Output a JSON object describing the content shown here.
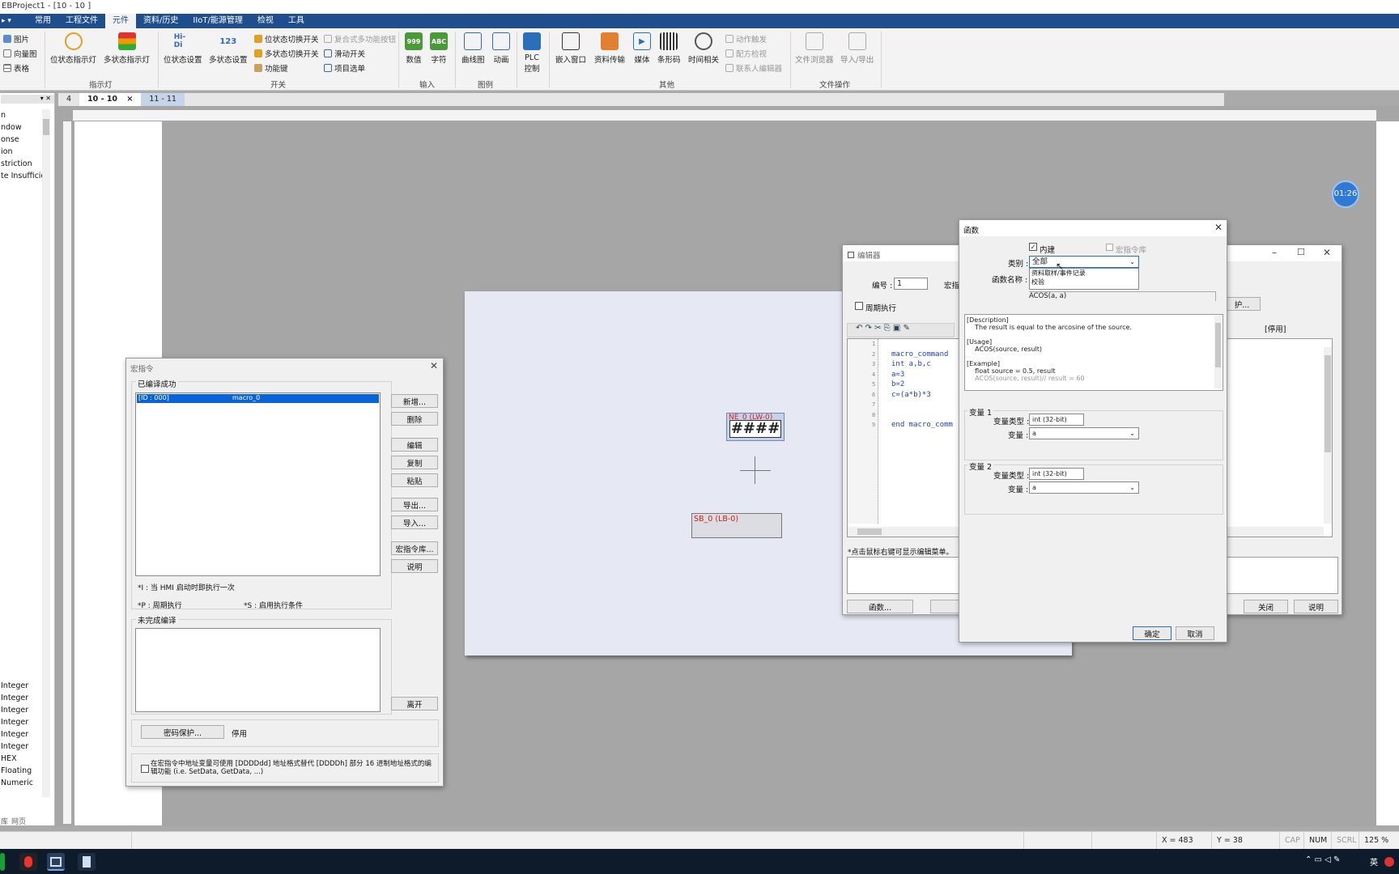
{
  "window": {
    "title": "EBProject1 - [10 - 10 ]",
    "quick_access": "▸ ▾"
  },
  "menu": [
    "常用",
    "工程文件",
    "元件",
    "资料/历史",
    "IIoT/能源管理",
    "检视",
    "工具"
  ],
  "menu_active": "元件",
  "ribbon": {
    "small_left": [
      "图片",
      "向量图",
      "表格"
    ],
    "indicator": [
      "位状态指示灯",
      "多状态指示灯"
    ],
    "indicator_group": "指示灯",
    "switch_big": [
      "位状态设置",
      "多状态设置"
    ],
    "switch_small": [
      "位状态切换开关",
      "多状态切换开关",
      "功能键",
      "复合式多功能按钮",
      "滑动开关",
      "项目选单"
    ],
    "switch_group": "开关",
    "input": [
      "数值",
      "字符"
    ],
    "input_group": "输入",
    "graph": [
      "曲线图",
      "动画"
    ],
    "graph_group": "图例",
    "plc": "PLC 控制",
    "other": [
      "嵌入窗口",
      "资料传输",
      "媒体",
      "条形码",
      "时间相关"
    ],
    "other_small": [
      "动作触发",
      "配方检视",
      "联系人编辑器"
    ],
    "other_group": "其他",
    "file": [
      "文件浏览器",
      "导入/导出"
    ],
    "file_group": "文件操作",
    "icons": {
      "number": "999",
      "char": "ABC",
      "bit_set": "Hi-Di",
      "multi_set": "123"
    }
  },
  "tabs": [
    "4",
    "10 - 10",
    "11 - 11"
  ],
  "tab_close": "×",
  "left_panel": {
    "top_items": [
      "n",
      "ndow",
      "onse",
      "ion",
      "striction",
      "te Insufficier"
    ],
    "bottom_items": [
      "Integer",
      "Integer",
      "Integer",
      "Integer",
      "Integer",
      "Integer",
      "HEX",
      "Floating",
      "Numeric"
    ],
    "footer": [
      "库",
      "网页"
    ]
  },
  "design": {
    "numeric_label": "NE_0 (LW-0)",
    "numeric_value": "####",
    "switch_label": "SB_0 (LB-0)"
  },
  "timer": "01:26",
  "macro_dialog": {
    "title": "宏指令",
    "compiled_label": "已编译成功",
    "list": [
      {
        "id": "[ID : 000]",
        "name": "macro_0"
      }
    ],
    "buttons": [
      "新增...",
      "删除",
      "编辑",
      "复制",
      "粘贴",
      "导出...",
      "导入...",
      "宏指令库...",
      "说明"
    ],
    "note_i": "*I : 当 HMI 启动时即执行一次",
    "note_p": "*P : 周期执行",
    "note_s": "*S : 启用执行条件",
    "uncompiled_label": "未完成编译",
    "leave": "离开",
    "pwd_button": "密码保护...",
    "disabled": "停用",
    "checkbox_text": "在宏指令中地址变量可使用 [DDDDdd] 地址格式替代 [DDDDh] 部分 16 进制地址格式的编辑功能 (i.e. SetData, GetData, ...)"
  },
  "editor": {
    "title": "编辑器",
    "number_label": "编号 :",
    "number_value": "1",
    "macro_label": "宏指",
    "periodic": "周期执行",
    "lines": [
      "1",
      "2",
      "3",
      "4",
      "5",
      "6",
      "7",
      "8",
      "9"
    ],
    "code": [
      "",
      "macro_command",
      "int a,b,c",
      "a=3",
      "b=2",
      "c=(a*b)*3",
      "",
      "",
      "end macro_comm"
    ],
    "hint": "*点击鼠标右键可显示编辑菜单。",
    "func_btn": "函数...",
    "protect_btn": "护...",
    "disabled": "[停用]",
    "close_btn": "关闭",
    "help_btn": "说明"
  },
  "func_dialog": {
    "title": "函数",
    "builtin": "内建",
    "lib": "宏指令库",
    "category_label": "类别 :",
    "category_value": "全部",
    "dropdown_options": [
      "全部",
      "资料取样/事件记录",
      "校验"
    ],
    "name_label": "函数名称 :",
    "selected_func": "ACOS(a, a)",
    "desc": [
      "[Description]",
      "    The result is equal to the arcosine of the source.",
      "",
      "[Usage]",
      "    ACOS(source, result)",
      "",
      "[Example]",
      "    float source = 0.5, result",
      "    ACOS(source, result)// result = 60"
    ],
    "var1_title": "变量 1",
    "var2_title": "变量 2",
    "type_label": "变量类型 :",
    "var_label": "变量 :",
    "type_value": "int (32-bit)",
    "var_value": "a",
    "ok": "确定",
    "cancel": "取消"
  },
  "status": {
    "x": "X = 483",
    "y": "Y = 38",
    "cap": "CAP",
    "num": "NUM",
    "scrl": "SCRL",
    "zoom": "125 %"
  },
  "tray": {
    "lang": "英"
  }
}
